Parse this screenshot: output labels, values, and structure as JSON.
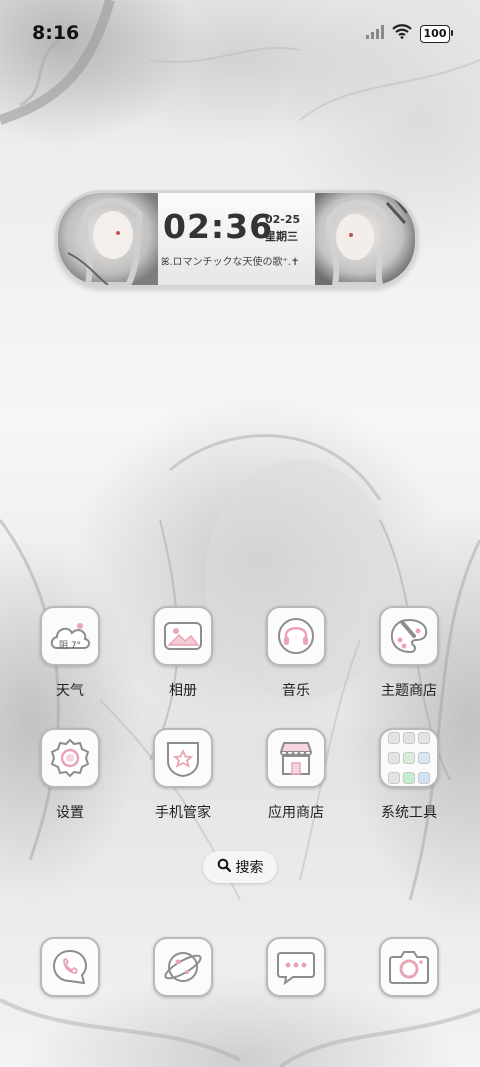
{
  "status_bar": {
    "time": "8:16",
    "battery": "100"
  },
  "widget": {
    "time": "02:36",
    "date": "02-25",
    "weekday": "星期三",
    "caption": "ꕤ.ロマンチックな天使の歌⁺.✝"
  },
  "apps": [
    {
      "label": "天气",
      "icon": "weather-icon",
      "badge": "阴 7°"
    },
    {
      "label": "相册",
      "icon": "gallery-icon"
    },
    {
      "label": "音乐",
      "icon": "headphones-icon"
    },
    {
      "label": "主题商店",
      "icon": "palette-icon"
    },
    {
      "label": "设置",
      "icon": "gear-icon"
    },
    {
      "label": "手机管家",
      "icon": "shield-star-icon"
    },
    {
      "label": "应用商店",
      "icon": "store-icon"
    },
    {
      "label": "系统工具",
      "icon": "folder-icon"
    }
  ],
  "search": {
    "label": "搜索",
    "icon": "search-icon"
  },
  "dock": [
    {
      "icon": "phone-icon"
    },
    {
      "icon": "browser-planet-icon"
    },
    {
      "icon": "message-icon"
    },
    {
      "icon": "camera-icon"
    }
  ],
  "colors": {
    "accent": "#e9a5b5",
    "icon_stroke": "#8d8d8d"
  }
}
